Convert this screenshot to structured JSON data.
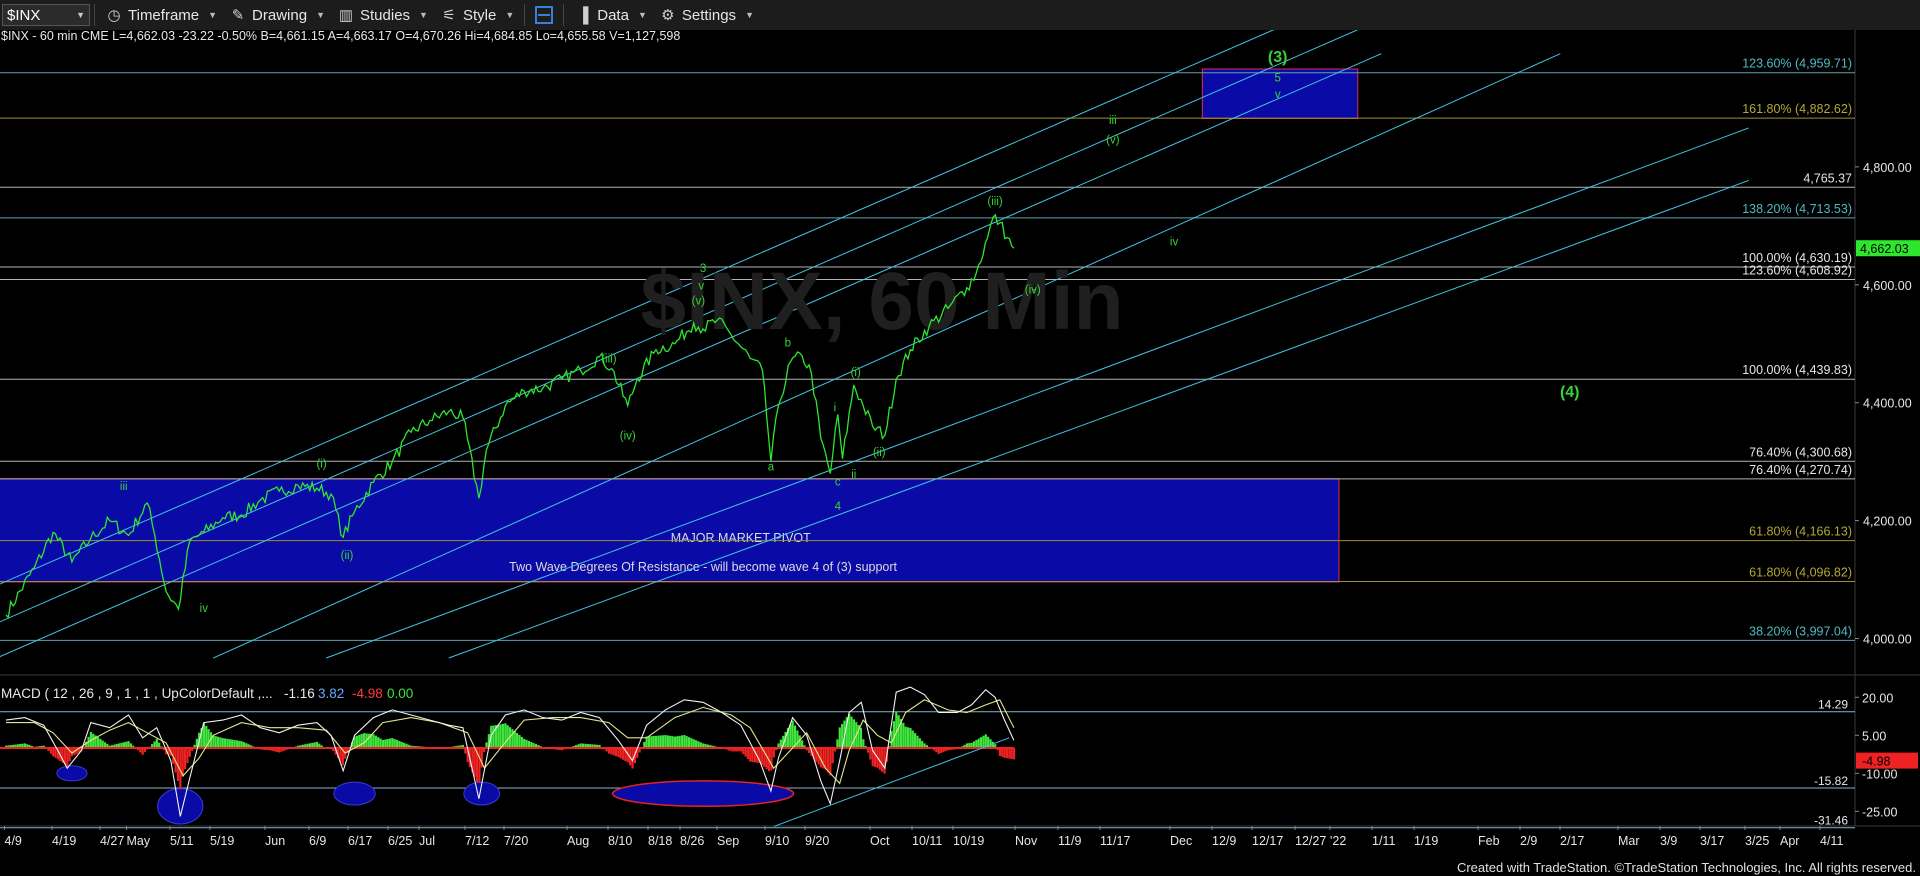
{
  "toolbar": {
    "symbol": "$INX",
    "timeframe": "Timeframe",
    "drawing": "Drawing",
    "studies": "Studies",
    "style": "Style",
    "data": "Data",
    "settings": "Settings"
  },
  "header_line": "$INX - 60 min  CME  L=4,662.03  -23.22  -0.50%  B=4,661.15  A=4,663.17  O=4,670.26  Hi=4,684.85  Lo=4,655.58  V=1,127,598",
  "macd_header": {
    "label": "MACD ( 12 , 26 , 9 , 1 , 1 , UpColorDefault ,...",
    "v1": "-1.16",
    "v2": "3.82",
    "v3": "-4.98",
    "v4": "0.00"
  },
  "copyright": "Created with TradeStation. ©TradeStation Technologies, Inc. All rights reserved.",
  "watermark": "$INX, 60 Min",
  "colors": {
    "price": "#2ee62e",
    "fib_line": "#6fa2b4",
    "channel": "#42c6e6",
    "fib_label": "#4fb9c2",
    "fib_label_gold": "#b4a732",
    "wave_label": "#36d336",
    "zone_fill": "#0a0aa6",
    "zone_border": "#d8304a",
    "macd_line": "#f2f2f2",
    "signal_line": "#e6e68c",
    "hist_pos": "#3ee63e",
    "hist_neg": "#ee2222",
    "ellipse": "#0a0aa6"
  },
  "chart_data": [
    {
      "type": "line",
      "title": "$INX - 60 min",
      "x_categories": [
        "4/9",
        "4/19",
        "4/27",
        "May",
        "5/11",
        "5/19",
        "Jun",
        "6/9",
        "6/17",
        "6/25",
        "Jul",
        "7/12",
        "7/20",
        "Aug",
        "8/10",
        "8/18",
        "8/26",
        "Sep",
        "9/10",
        "9/20",
        "Oct",
        "10/11",
        "10/19",
        "Nov",
        "11/9",
        "11/17",
        "Dec",
        "12/9",
        "12/17",
        "12/27",
        "'22",
        "1/11",
        "1/19",
        "Feb",
        "2/9",
        "2/17",
        "Mar",
        "3/9",
        "3/17",
        "3/25",
        "Apr",
        "4/11"
      ],
      "y_ticks": [
        {
          "value": 4000,
          "label": "4,000.00"
        },
        {
          "value": 4200,
          "label": "4,200.00"
        },
        {
          "value": 4400,
          "label": "4,400.00"
        },
        {
          "value": 4600,
          "label": "4,600.00"
        },
        {
          "value": 4800,
          "label": "4,800.00"
        }
      ],
      "ylim": [
        3945,
        5005
      ],
      "last_price": {
        "value": 4662.03,
        "label": "4,662.03"
      },
      "price_series": [
        [
          0,
          4040
        ],
        [
          3,
          4120
        ],
        [
          5,
          4180
        ],
        [
          7,
          4130
        ],
        [
          9,
          4170
        ],
        [
          11,
          4200
        ],
        [
          13,
          4175
        ],
        [
          15,
          4230
        ],
        [
          15.8,
          4175
        ],
        [
          17,
          4080
        ],
        [
          18.3,
          4050
        ],
        [
          19.5,
          4165
        ],
        [
          21,
          4180
        ],
        [
          23,
          4205
        ],
        [
          25,
          4210
        ],
        [
          27,
          4235
        ],
        [
          29,
          4250
        ],
        [
          31,
          4260
        ],
        [
          33,
          4255
        ],
        [
          34.5,
          4245
        ],
        [
          35.8,
          4172
        ],
        [
          37,
          4215
        ],
        [
          39,
          4265
        ],
        [
          41,
          4300
        ],
        [
          43,
          4350
        ],
        [
          45,
          4370
        ],
        [
          47,
          4385
        ],
        [
          48.5,
          4375
        ],
        [
          50.2,
          4238
        ],
        [
          51,
          4320
        ],
        [
          53,
          4395
        ],
        [
          55,
          4420
        ],
        [
          57,
          4425
        ],
        [
          59,
          4440
        ],
        [
          61,
          4455
        ],
        [
          63,
          4478
        ],
        [
          64.3,
          4458
        ],
        [
          66,
          4395
        ],
        [
          67,
          4440
        ],
        [
          69,
          4490
        ],
        [
          71,
          4500
        ],
        [
          73,
          4535
        ],
        [
          74,
          4525
        ],
        [
          75.5,
          4540
        ],
        [
          77,
          4515
        ],
        [
          79,
          4475
        ],
        [
          80.3,
          4455
        ],
        [
          81.2,
          4300
        ],
        [
          82,
          4395
        ],
        [
          83.3,
          4470
        ],
        [
          84.5,
          4480
        ],
        [
          85.5,
          4450
        ],
        [
          86.5,
          4340
        ],
        [
          87.5,
          4280
        ],
        [
          88.3,
          4380
        ],
        [
          88.8,
          4305
        ],
        [
          90,
          4430
        ],
        [
          91,
          4395
        ],
        [
          92,
          4360
        ],
        [
          93.3,
          4345
        ],
        [
          94.5,
          4440
        ],
        [
          96,
          4490
        ],
        [
          98,
          4530
        ],
        [
          100,
          4560
        ],
        [
          102,
          4595
        ],
        [
          103,
          4620
        ],
        [
          104.2,
          4680
        ],
        [
          104.8,
          4715
        ],
        [
          105.5,
          4705
        ],
        [
          106.3,
          4680
        ],
        [
          107,
          4662
        ]
      ],
      "channel_lines": [
        [
          -1,
          3967,
          146,
          4992
        ],
        [
          -1,
          4026,
          146,
          5050
        ],
        [
          -1,
          4090,
          146,
          5112
        ],
        [
          22,
          3967,
          165,
          4992
        ],
        [
          34,
          3967,
          185,
          4866
        ],
        [
          47,
          3967,
          185,
          4777
        ]
      ],
      "fib_levels": [
        {
          "value": 4959.71,
          "label": "123.60% (4,959.71)",
          "tone": "cyan"
        },
        {
          "value": 4882.62,
          "label": "161.80% (4,882.62)",
          "tone": "gold"
        },
        {
          "value": 4765.37,
          "label": "4,765.37",
          "tone": "white"
        },
        {
          "value": 4713.53,
          "label": "138.20% (4,713.53)",
          "tone": "cyan"
        },
        {
          "value": 4630.19,
          "label": "100.00% (4,630.19)",
          "tone": "white"
        },
        {
          "value": 4608.92,
          "label": "123.60% (4,608.92)",
          "tone": "white"
        },
        {
          "value": 4439.83,
          "label": "100.00% (4,439.83)",
          "tone": "white"
        },
        {
          "value": 4300.68,
          "label": "76.40% (4,300.68)",
          "tone": "white"
        },
        {
          "value": 4270.74,
          "label": "76.40% (4,270.74)",
          "tone": "white"
        },
        {
          "value": 4166.13,
          "label": "61.80% (4,166.13)",
          "tone": "gold"
        },
        {
          "value": 4096.82,
          "label": "61.80% (4,096.82)",
          "tone": "gold"
        },
        {
          "value": 3997.04,
          "label": "38.20% (3,997.04)",
          "tone": "cyan"
        }
      ],
      "zones": [
        {
          "x0": -1,
          "x1": 141.5,
          "y0": 4271,
          "y1": 4096,
          "label": "MAJOR MARKET PIVOT",
          "label2": "Two Wave Degrees Of Resistance - will become wave 4 of (3) support"
        },
        {
          "x0": 127,
          "x1": 143.5,
          "y0": 4966,
          "y1": 4882
        }
      ],
      "wave_labels": [
        {
          "x": 12.5,
          "y": 4252,
          "t": "iii"
        },
        {
          "x": 21,
          "y": 4045,
          "t": "iv"
        },
        {
          "x": 33.5,
          "y": 4290,
          "t": "(i)"
        },
        {
          "x": 36.2,
          "y": 4135,
          "t": "(ii)"
        },
        {
          "x": 64,
          "y": 4468,
          "t": "(iii)"
        },
        {
          "x": 66,
          "y": 4338,
          "t": "(iv)"
        },
        {
          "x": 73.5,
          "y": 4567,
          "t": "(v)"
        },
        {
          "x": 73.8,
          "y": 4592,
          "t": "v"
        },
        {
          "x": 74,
          "y": 4622,
          "t": "3"
        },
        {
          "x": 81.2,
          "y": 4285,
          "t": "a"
        },
        {
          "x": 83,
          "y": 4495,
          "t": "b"
        },
        {
          "x": 88.3,
          "y": 4260,
          "t": "c"
        },
        {
          "x": 88.3,
          "y": 4218,
          "t": "4"
        },
        {
          "x": 90,
          "y": 4272,
          "t": "ii"
        },
        {
          "x": 88,
          "y": 4385,
          "t": "i"
        },
        {
          "x": 90.2,
          "y": 4445,
          "t": "(i)"
        },
        {
          "x": 92.7,
          "y": 4310,
          "t": "(ii)"
        },
        {
          "x": 105,
          "y": 4735,
          "t": "(iii)"
        },
        {
          "x": 109,
          "y": 4585,
          "t": "(iv)"
        },
        {
          "x": 117.5,
          "y": 4840,
          "t": "(v)"
        },
        {
          "x": 117.5,
          "y": 4873,
          "t": "iii"
        },
        {
          "x": 124,
          "y": 4667,
          "t": "iv"
        },
        {
          "x": 135,
          "y": 4917,
          "t": "v"
        },
        {
          "x": 135,
          "y": 4945,
          "t": "5"
        },
        {
          "x": 135,
          "y": 4978,
          "t": "(3)"
        },
        {
          "x": 166,
          "y": 4410,
          "t": "(4)"
        }
      ],
      "watermark_pos": {
        "x": 93,
        "y": 4525
      }
    },
    {
      "type": "line",
      "title": "MACD ( 12 , 26 , 9 , 1 , 1 , UpColorDefault ,...",
      "y_ticks": [
        {
          "value": 20,
          "label": "20.00"
        },
        {
          "value": 5,
          "label": "5.00"
        },
        {
          "value": -10,
          "label": "-10.00"
        },
        {
          "value": -25,
          "label": "-25.00"
        }
      ],
      "ylim": [
        -30,
        28
      ],
      "levels": [
        {
          "value": 14.29,
          "label": "14.29"
        },
        {
          "value": -15.82,
          "label": "-15.82"
        },
        {
          "value": -31.46,
          "label": "-31.46"
        }
      ],
      "last_value": {
        "value": -4.98,
        "label": "-4.98"
      },
      "macd_series": [
        [
          0,
          11
        ],
        [
          2,
          12
        ],
        [
          4,
          9
        ],
        [
          5.5,
          -1
        ],
        [
          6.5,
          -8
        ],
        [
          8,
          -1
        ],
        [
          9,
          10
        ],
        [
          11,
          8
        ],
        [
          13,
          13
        ],
        [
          14.5,
          4
        ],
        [
          16,
          8
        ],
        [
          17.5,
          -5
        ],
        [
          18.5,
          -27
        ],
        [
          19.5,
          -12
        ],
        [
          21,
          10
        ],
        [
          23,
          11
        ],
        [
          25,
          13
        ],
        [
          27,
          8
        ],
        [
          29,
          6
        ],
        [
          31,
          9
        ],
        [
          33,
          10
        ],
        [
          34.5,
          5
        ],
        [
          35.8,
          -9
        ],
        [
          37,
          5
        ],
        [
          39,
          12
        ],
        [
          41,
          15
        ],
        [
          43,
          13
        ],
        [
          45,
          11
        ],
        [
          47,
          9
        ],
        [
          48.5,
          8
        ],
        [
          50.2,
          -20
        ],
        [
          51.5,
          5
        ],
        [
          53,
          13
        ],
        [
          55,
          15
        ],
        [
          57,
          12
        ],
        [
          59,
          11
        ],
        [
          61,
          14
        ],
        [
          63,
          12
        ],
        [
          65,
          3
        ],
        [
          66.5,
          -5
        ],
        [
          68,
          9
        ],
        [
          70,
          15
        ],
        [
          72,
          19
        ],
        [
          74,
          18
        ],
        [
          76,
          14
        ],
        [
          78,
          9
        ],
        [
          80,
          -5
        ],
        [
          81.2,
          -17
        ],
        [
          82,
          -4
        ],
        [
          83.5,
          12
        ],
        [
          85,
          5
        ],
        [
          86.5,
          -13
        ],
        [
          87.5,
          -22
        ],
        [
          88.5,
          -5
        ],
        [
          89.5,
          14
        ],
        [
          90.8,
          18
        ],
        [
          92,
          -1
        ],
        [
          93.3,
          -8
        ],
        [
          94.5,
          22
        ],
        [
          96,
          24
        ],
        [
          97.5,
          21
        ],
        [
          99,
          14
        ],
        [
          101,
          14
        ],
        [
          102.5,
          17
        ],
        [
          104,
          23
        ],
        [
          105,
          20
        ],
        [
          106,
          11
        ],
        [
          107,
          3
        ]
      ],
      "signal_series": [
        [
          0,
          10
        ],
        [
          3,
          10
        ],
        [
          5,
          6
        ],
        [
          7,
          -2
        ],
        [
          9,
          3
        ],
        [
          11,
          7
        ],
        [
          13,
          10
        ],
        [
          15,
          6
        ],
        [
          17,
          2
        ],
        [
          18.8,
          -11
        ],
        [
          20.5,
          -4
        ],
        [
          22,
          5
        ],
        [
          25,
          10
        ],
        [
          28,
          8
        ],
        [
          31,
          8
        ],
        [
          34,
          7
        ],
        [
          36,
          -2
        ],
        [
          38,
          2
        ],
        [
          40,
          10
        ],
        [
          43,
          12
        ],
        [
          46,
          10
        ],
        [
          49,
          6
        ],
        [
          50.8,
          -8
        ],
        [
          52.5,
          0
        ],
        [
          55,
          11
        ],
        [
          58,
          12
        ],
        [
          61,
          12
        ],
        [
          64,
          10
        ],
        [
          66,
          4
        ],
        [
          68,
          4
        ],
        [
          71,
          12
        ],
        [
          74,
          16
        ],
        [
          77,
          13
        ],
        [
          79,
          8
        ],
        [
          81.5,
          -8
        ],
        [
          83,
          -2
        ],
        [
          85,
          6
        ],
        [
          87,
          -8
        ],
        [
          88.5,
          -14
        ],
        [
          89.5,
          -1
        ],
        [
          91,
          11
        ],
        [
          92.5,
          5
        ],
        [
          94,
          2
        ],
        [
          95.5,
          14
        ],
        [
          97.5,
          19
        ],
        [
          100,
          15
        ],
        [
          102,
          14
        ],
        [
          104,
          17
        ],
        [
          105.5,
          19
        ],
        [
          107,
          8
        ]
      ],
      "trendline": [
        81.5,
        -31,
        106.5,
        4
      ],
      "ellipses": [
        {
          "cx": 7,
          "cy": -10,
          "rx": 1.6,
          "ry": 3,
          "sel": false
        },
        {
          "cx": 18.5,
          "cy": -23,
          "rx": 2.4,
          "ry": 7,
          "sel": false
        },
        {
          "cx": 37,
          "cy": -18,
          "rx": 2.2,
          "ry": 4.5,
          "sel": false
        },
        {
          "cx": 50.5,
          "cy": -18,
          "rx": 1.9,
          "ry": 4.5,
          "sel": false
        },
        {
          "cx": 74,
          "cy": -18,
          "rx": 9.6,
          "ry": 5,
          "sel": true
        }
      ]
    }
  ]
}
